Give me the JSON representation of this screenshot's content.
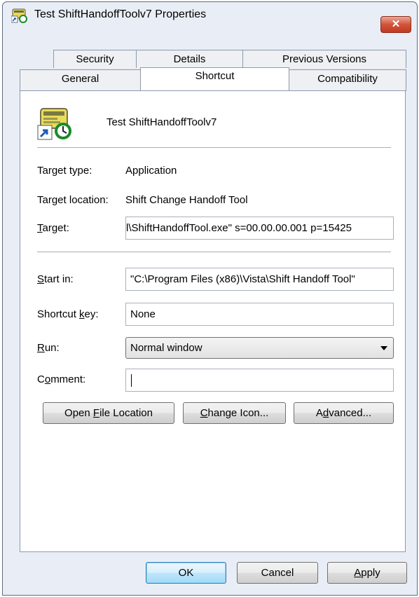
{
  "window": {
    "title": "Test ShiftHandoffToolv7 Properties",
    "close_label": "✕"
  },
  "tabs": {
    "row1": [
      {
        "label": "Security"
      },
      {
        "label": "Details"
      },
      {
        "label": "Previous Versions"
      }
    ],
    "row2": [
      {
        "label": "General"
      },
      {
        "label": "Shortcut",
        "active": true
      },
      {
        "label": "Compatibility"
      }
    ]
  },
  "shortcut": {
    "name": "Test ShiftHandoffToolv7",
    "icon": "shortcut-app-icon",
    "target_type_label": "Target type:",
    "target_type_value": "Application",
    "target_location_label": "Target location:",
    "target_location_value": "Shift Change Handoff Tool",
    "target_label_u": "T",
    "target_label_rest": "arget:",
    "target_value": "l\\ShiftHandoffTool.exe\" s=00.00.00.001 p=15425",
    "start_in_label_u": "S",
    "start_in_label_rest": "tart in:",
    "start_in_value": "\"C:\\Program Files (x86)\\Vista\\Shift Handoff Tool\"",
    "shortcut_key_label_pre": "Shortcut ",
    "shortcut_key_label_u": "k",
    "shortcut_key_label_post": "ey:",
    "shortcut_key_value": "None",
    "run_label_u": "R",
    "run_label_rest": "un:",
    "run_value": "Normal window",
    "comment_label_pre": "C",
    "comment_label_u": "o",
    "comment_label_post": "mment:",
    "comment_value": ""
  },
  "action_buttons": {
    "open_file_pre": "Open ",
    "open_file_u": "F",
    "open_file_post": "ile Location",
    "change_icon_u": "C",
    "change_icon_post": "hange Icon...",
    "advanced_pre": "A",
    "advanced_u": "d",
    "advanced_post": "vanced..."
  },
  "dialog_buttons": {
    "ok": "OK",
    "cancel": "Cancel",
    "apply_u": "A",
    "apply_post": "pply"
  },
  "colors": {
    "frame": "#e9eef6",
    "close_button": "#c8432b",
    "panel": "#ffffff"
  }
}
